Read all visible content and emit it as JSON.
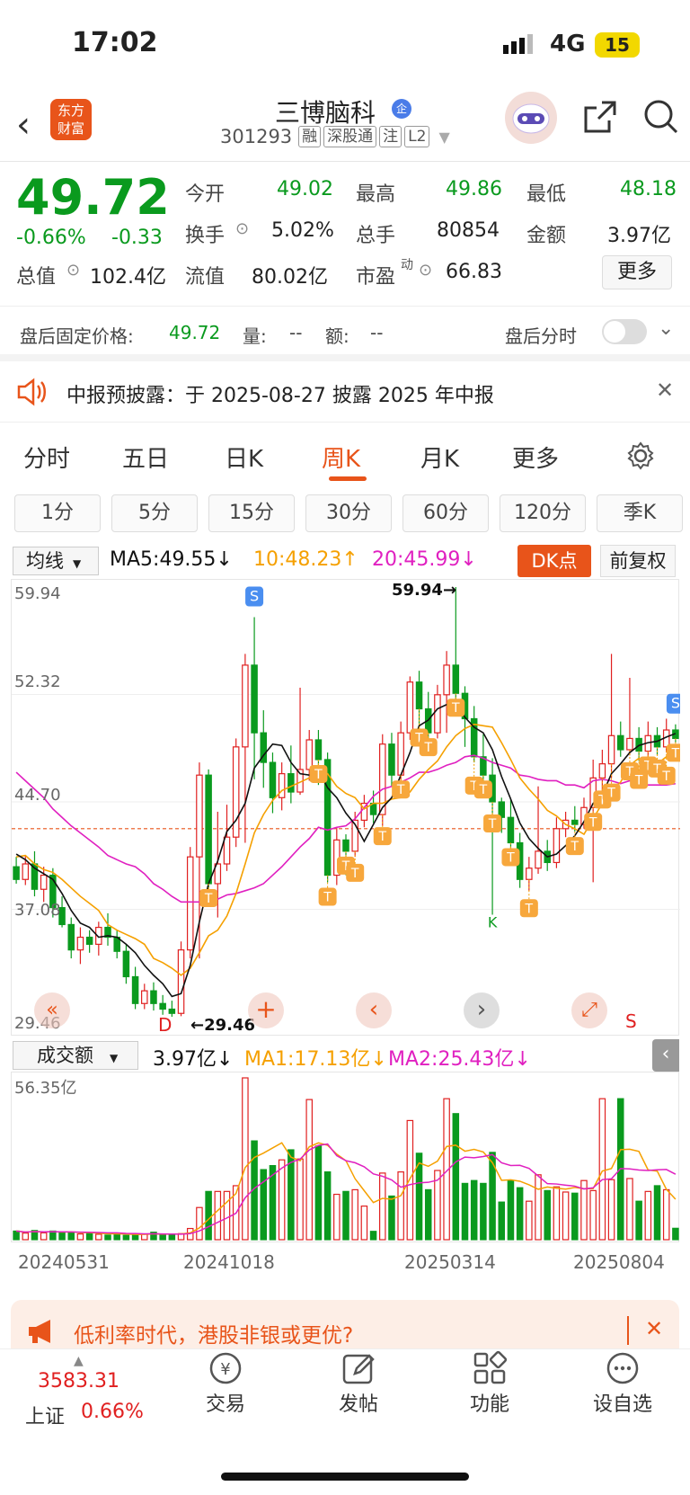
{
  "status": {
    "time": "17:02",
    "network": "4G",
    "battery": "15"
  },
  "header": {
    "brand_line1": "东方",
    "brand_line2": "财富",
    "stock_name": "三博脑科",
    "badge": "企",
    "code": "301293",
    "tags": [
      "融",
      "深股通",
      "注",
      "L2"
    ]
  },
  "quote": {
    "price": "49.72",
    "change_pct": "-0.66%",
    "change": "-0.33",
    "open_label": "今开",
    "open": "49.02",
    "high_label": "最高",
    "high": "49.86",
    "low_label": "最低",
    "low": "48.18",
    "turnover_label": "换手",
    "turnover": "5.02%",
    "volume_label": "总手",
    "volume": "80854",
    "amount_label": "金额",
    "amount": "3.97亿",
    "mktcap_label": "总值",
    "mktcap": "102.4亿",
    "float_label": "流值",
    "float": "80.02亿",
    "pe_label": "市盈",
    "pe_sup": "动",
    "pe": "66.83",
    "more": "更多"
  },
  "after_hours": {
    "price_label": "盘后固定价格:",
    "price": "49.72",
    "vol_label": "量:",
    "vol": "--",
    "amt_label": "额:",
    "amt": "--",
    "toggle_label": "盘后分时"
  },
  "notice": {
    "text": "中报预披露：于 2025-08-27 披露 2025 年中报"
  },
  "tabs": [
    "分时",
    "五日",
    "日K",
    "周K",
    "月K",
    "更多"
  ],
  "periods": [
    "1分",
    "5分",
    "15分",
    "30分",
    "60分",
    "120分",
    "季K"
  ],
  "indicator": {
    "select": "均线",
    "ma5": "MA5:49.55",
    "ma10": "10:48.23",
    "ma20": "20:45.99",
    "dk": "DK点",
    "fq": "前复权"
  },
  "price_axis": [
    "59.94",
    "52.32",
    "44.70",
    "37.08",
    "29.46"
  ],
  "chart_marks": {
    "high_label": "59.94",
    "low_label": "29.46",
    "d_label": "D"
  },
  "volume_panel": {
    "select": "成交额",
    "value": "3.97亿",
    "ma1": "MA1:17.13亿",
    "ma2": "MA2:25.43亿",
    "max": "56.35亿"
  },
  "dates": [
    "20240531",
    "20241018",
    "20250314",
    "20250804"
  ],
  "ad": {
    "text": "低利率时代，港股非银或更优?"
  },
  "bottom_nav": {
    "index_value": "3583.31",
    "index_name": "上证",
    "index_pct": "0.66%",
    "trade": "交易",
    "post": "发帖",
    "func": "功能",
    "watch": "设自选"
  },
  "chart_data": {
    "type": "candlestick",
    "price_range": [
      29.46,
      59.94
    ],
    "candles": [
      [
        40.1,
        39.2,
        40.8,
        38.9
      ],
      [
        39.2,
        40.3,
        40.9,
        38.8
      ],
      [
        40.3,
        38.5,
        41.2,
        38.0
      ],
      [
        38.5,
        39.5,
        40.1,
        37.6
      ],
      [
        39.5,
        37.2,
        40.0,
        36.5
      ],
      [
        37.2,
        36.0,
        38.0,
        35.8
      ],
      [
        36.0,
        34.2,
        36.5,
        33.6
      ],
      [
        34.2,
        35.1,
        35.8,
        33.2
      ],
      [
        35.1,
        34.6,
        35.6,
        34.0
      ],
      [
        34.6,
        35.8,
        36.2,
        33.8
      ],
      [
        35.8,
        35.1,
        36.8,
        34.5
      ],
      [
        35.1,
        34.1,
        35.6,
        33.6
      ],
      [
        34.1,
        32.3,
        34.6,
        31.8
      ],
      [
        32.3,
        30.4,
        33.0,
        30.0
      ],
      [
        30.4,
        31.3,
        31.8,
        30.0
      ],
      [
        31.3,
        30.4,
        31.9,
        29.9
      ],
      [
        30.4,
        30.0,
        31.0,
        29.6
      ],
      [
        30.0,
        29.7,
        30.6,
        29.46
      ],
      [
        29.7,
        34.2,
        34.8,
        29.5
      ],
      [
        34.2,
        40.8,
        41.5,
        33.6
      ],
      [
        40.8,
        46.6,
        47.5,
        33.6
      ],
      [
        46.6,
        38.9,
        47.0,
        38.2
      ],
      [
        38.9,
        40.3,
        44.0,
        36.5
      ],
      [
        40.3,
        42.2,
        44.5,
        39.8
      ],
      [
        42.2,
        48.6,
        49.2,
        41.5
      ],
      [
        48.6,
        54.4,
        55.2,
        41.8
      ],
      [
        54.4,
        49.6,
        57.8,
        46.3
      ],
      [
        49.6,
        47.5,
        51.2,
        45.7
      ],
      [
        47.5,
        45.0,
        48.2,
        43.9
      ],
      [
        45.0,
        46.7,
        47.5,
        44.1
      ],
      [
        46.7,
        45.4,
        48.7,
        44.6
      ],
      [
        45.4,
        47.0,
        52.8,
        45.2
      ],
      [
        47.0,
        49.1,
        49.8,
        46.2
      ],
      [
        49.1,
        47.7,
        49.8,
        45.9
      ],
      [
        47.7,
        39.5,
        48.2,
        39.0
      ],
      [
        39.5,
        42.0,
        42.9,
        38.8
      ],
      [
        42.0,
        41.2,
        42.4,
        39.5
      ],
      [
        41.2,
        43.4,
        44.0,
        40.8
      ],
      [
        43.4,
        44.6,
        45.2,
        42.9
      ],
      [
        44.6,
        43.8,
        45.5,
        43.2
      ],
      [
        43.8,
        48.8,
        49.5,
        43.0
      ],
      [
        48.8,
        46.6,
        49.6,
        45.8
      ],
      [
        46.6,
        49.6,
        50.4,
        46.0
      ],
      [
        49.6,
        53.2,
        53.6,
        49.1
      ],
      [
        53.2,
        51.3,
        54.0,
        48.7
      ],
      [
        51.3,
        49.6,
        52.5,
        48.5
      ],
      [
        49.6,
        52.3,
        53.0,
        49.2
      ],
      [
        52.3,
        54.4,
        55.4,
        49.6
      ],
      [
        54.4,
        52.4,
        59.94,
        51.6
      ],
      [
        52.4,
        50.6,
        52.9,
        48.6
      ],
      [
        50.6,
        47.9,
        51.5,
        47.5
      ],
      [
        47.9,
        46.6,
        49.5,
        46.0
      ],
      [
        46.6,
        44.7,
        47.8,
        36.7
      ],
      [
        44.7,
        43.6,
        45.0,
        42.5
      ],
      [
        43.6,
        41.8,
        44.9,
        41.0
      ],
      [
        41.8,
        39.2,
        42.5,
        38.6
      ],
      [
        39.2,
        40.0,
        40.8,
        38.4
      ],
      [
        40.0,
        41.2,
        45.8,
        39.6
      ],
      [
        41.2,
        40.4,
        42.0,
        39.8
      ],
      [
        40.4,
        42.8,
        43.6,
        40.0
      ],
      [
        42.8,
        43.4,
        44.0,
        42.2
      ],
      [
        43.4,
        43.1,
        44.4,
        42.6
      ],
      [
        43.1,
        44.3,
        45.0,
        42.8
      ],
      [
        44.3,
        46.4,
        47.7,
        39.0
      ],
      [
        46.4,
        47.4,
        48.4,
        45.5
      ],
      [
        47.4,
        49.4,
        55.2,
        46.4
      ],
      [
        49.4,
        48.4,
        50.4,
        47.9
      ],
      [
        48.4,
        49.2,
        53.5,
        48.0
      ],
      [
        49.2,
        48.3,
        50.0,
        47.6
      ],
      [
        48.3,
        49.4,
        50.4,
        47.8
      ],
      [
        49.4,
        48.6,
        50.0,
        48.0
      ],
      [
        48.6,
        49.8,
        50.6,
        48.2
      ],
      [
        49.8,
        49.2,
        50.2,
        48.9
      ]
    ],
    "volumes": [
      3.0,
      2.3,
      3.2,
      2.4,
      3.0,
      2.5,
      2.5,
      2.0,
      2.4,
      1.9,
      1.6,
      2.3,
      1.5,
      1.8,
      2.0,
      2.6,
      1.7,
      1.6,
      2.1,
      3.9,
      11.2,
      16.8,
      16.8,
      16.8,
      18.8,
      56.35,
      34.4,
      24.4,
      25.8,
      27.8,
      31.3,
      28.1,
      48.8,
      32.6,
      23.6,
      15.8,
      16.8,
      17.4,
      11.7,
      2.9,
      23.2,
      15.2,
      23.6,
      41.5,
      30.1,
      17.4,
      24.1,
      49.1,
      43.9,
      19.6,
      20.6,
      19.6,
      30.4,
      13.1,
      20.6,
      18.1,
      13.4,
      22.6,
      17.1,
      18.4,
      16.6,
      16.2,
      20.6,
      17.1,
      49.1,
      20.9,
      49.1,
      21.3,
      13.4,
      16.8,
      18.8,
      17.4,
      3.97
    ],
    "ma5_line": [
      41.0,
      40.6,
      40.0,
      39.6,
      39.2,
      38.2,
      37.0,
      36.1,
      35.8,
      35.1,
      35.2,
      35.1,
      34.6,
      34.0,
      33.1,
      32.4,
      31.8,
      30.9,
      31.1,
      33.1,
      36.2,
      38.9,
      40.5,
      42.6,
      43.4,
      44.6,
      47.1,
      48.0,
      48.8,
      48.7,
      47.5,
      46.7,
      46.6,
      47.0,
      45.7,
      45.0,
      43.9,
      43.1,
      41.9,
      43.1,
      44.3,
      45.0,
      46.6,
      48.2,
      50.1,
      50.5,
      51.3,
      51.6,
      51.8,
      50.7,
      50.0,
      49.6,
      48.4,
      46.5,
      44.9,
      43.2,
      42.1,
      41.4,
      40.8,
      41.0,
      41.6,
      42.3,
      43.3,
      44.6,
      45.2,
      46.7,
      47.4,
      48.2,
      48.7,
      48.9,
      49.0,
      49.3,
      49.55
    ],
    "ma10_line": [
      40.8,
      40.9,
      40.3,
      39.9,
      39.7,
      39.2,
      38.6,
      38.0,
      37.5,
      37.0,
      36.0,
      35.6,
      35.3,
      35.0,
      34.6,
      33.6,
      33.3,
      32.9,
      32.4,
      32.9,
      34.0,
      35.2,
      35.6,
      36.6,
      38.2,
      40.3,
      42.5,
      43.8,
      44.8,
      45.5,
      45.8,
      46.1,
      46.4,
      46.8,
      46.7,
      45.8,
      45.3,
      45.0,
      44.2,
      44.6,
      44.6,
      44.9,
      45.0,
      45.4,
      46.3,
      47.0,
      47.6,
      48.6,
      49.4,
      49.9,
      50.2,
      50.1,
      50.0,
      48.9,
      47.7,
      46.4,
      45.6,
      44.9,
      44.1,
      43.7,
      43.1,
      42.8,
      42.4,
      43.5,
      44.6,
      45.5,
      46.1,
      47.3,
      47.8,
      47.2,
      47.4,
      47.9,
      48.23
    ],
    "ma20_line": [
      46.8,
      46.2,
      45.6,
      45.0,
      44.2,
      43.6,
      43.0,
      42.5,
      42.0,
      41.5,
      40.9,
      40.6,
      40.3,
      40.1,
      39.6,
      38.9,
      38.5,
      38.0,
      37.6,
      37.6,
      37.6,
      37.8,
      37.8,
      38.1,
      38.2,
      38.4,
      38.6,
      38.9,
      39.5,
      40.1,
      40.8,
      41.5,
      42.1,
      42.9,
      42.7,
      42.9,
      43.0,
      43.5,
      44.3,
      45.1,
      45.6,
      45.8,
      46.1,
      46.4,
      46.8,
      46.8,
      47.0,
      47.3,
      47.5,
      47.9,
      48.0,
      47.8,
      47.5,
      47.3,
      47.1,
      46.6,
      46.5,
      46.3,
      46.2,
      46.2,
      45.9,
      45.9,
      45.7,
      46.2,
      46.3,
      46.2,
      46.0,
      46.2,
      46.0,
      45.9,
      45.9,
      45.9,
      45.99
    ],
    "support_line": 42.8,
    "signals": [
      {
        "i": 26,
        "type": "S"
      },
      {
        "i": 72,
        "type": "S"
      },
      {
        "i": 52,
        "type": "K"
      }
    ]
  }
}
